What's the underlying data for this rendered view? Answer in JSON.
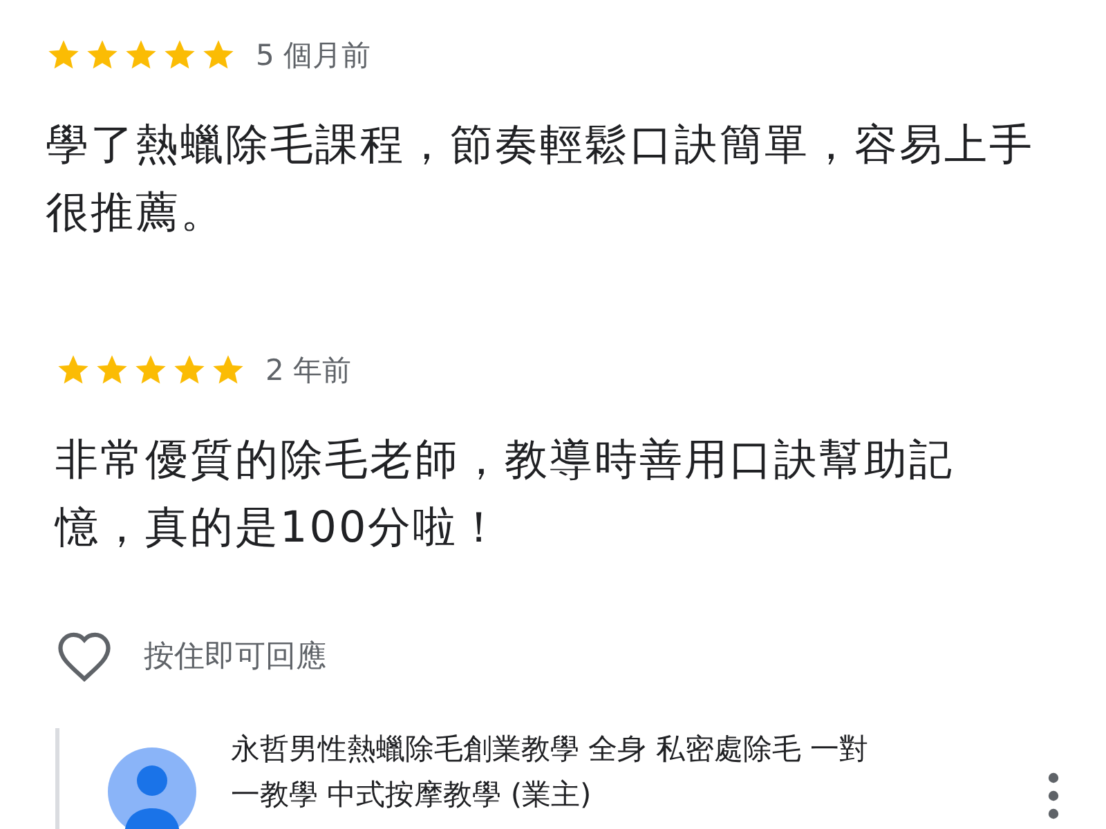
{
  "reviews": [
    {
      "stars": 5,
      "time": "5 個月前",
      "text": "學了熱蠟除毛課程，節奏輕鬆口訣簡單，容易上手很推薦。"
    },
    {
      "stars": 5,
      "time": "2 年前",
      "text": "非常優質的除毛老師，教導時善用口訣幫助記憶，真的是100分啦！"
    }
  ],
  "like": {
    "label": "按住即可回應",
    "liked": false
  },
  "owner_reply": {
    "name": "永哲男性熱蠟除毛創業教學 全身 私密處除毛 一對一教學 中式按摩教學 (業主)"
  }
}
